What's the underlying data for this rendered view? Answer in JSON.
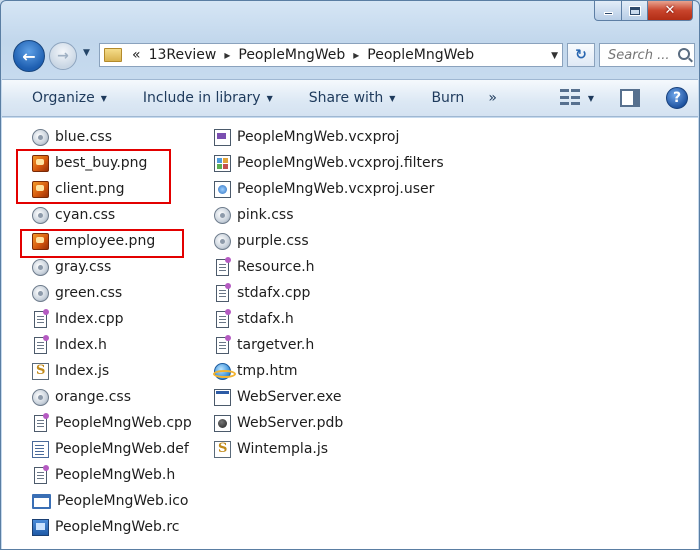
{
  "window": {
    "caption_close": "✕"
  },
  "nav": {
    "back_glyph": "←",
    "forward_glyph": "→",
    "breadcrumb_overflow": "«",
    "breadcrumb": [
      "13Review",
      "PeopleMngWeb",
      "PeopleMngWeb"
    ],
    "breadcrumb_sep": "▸",
    "refresh_glyph": "↻",
    "search_placeholder": "Search ..."
  },
  "toolbar": {
    "organize": "Organize",
    "include_in_library": "Include in library",
    "share_with": "Share with",
    "burn": "Burn",
    "more": "»",
    "dropdown_glyph": "▼",
    "help": "?"
  },
  "files": {
    "column1": [
      {
        "name": "blue.css",
        "icon": "css-file-icon"
      },
      {
        "name": "best_buy.png",
        "icon": "png-image-icon"
      },
      {
        "name": "client.png",
        "icon": "png-image-icon"
      },
      {
        "name": "cyan.css",
        "icon": "css-file-icon"
      },
      {
        "name": "employee.png",
        "icon": "png-image-icon"
      },
      {
        "name": "gray.css",
        "icon": "css-file-icon"
      },
      {
        "name": "green.css",
        "icon": "css-file-icon"
      },
      {
        "name": "Index.cpp",
        "icon": "cpp-file-icon"
      },
      {
        "name": "Index.h",
        "icon": "header-file-icon"
      },
      {
        "name": "Index.js",
        "icon": "js-file-icon"
      },
      {
        "name": "orange.css",
        "icon": "css-file-icon"
      },
      {
        "name": "PeopleMngWeb.cpp",
        "icon": "cpp-file-icon"
      },
      {
        "name": "PeopleMngWeb.def",
        "icon": "def-file-icon"
      },
      {
        "name": "PeopleMngWeb.h",
        "icon": "header-file-icon"
      },
      {
        "name": "PeopleMngWeb.ico",
        "icon": "ico-file-icon"
      },
      {
        "name": "PeopleMngWeb.rc",
        "icon": "rc-file-icon"
      }
    ],
    "column2": [
      {
        "name": "PeopleMngWeb.vcxproj",
        "icon": "vcxproj-file-icon"
      },
      {
        "name": "PeopleMngWeb.vcxproj.filters",
        "icon": "filters-file-icon"
      },
      {
        "name": "PeopleMngWeb.vcxproj.user",
        "icon": "user-file-icon"
      },
      {
        "name": "pink.css",
        "icon": "css-file-icon"
      },
      {
        "name": "purple.css",
        "icon": "css-file-icon"
      },
      {
        "name": "Resource.h",
        "icon": "header-file-icon"
      },
      {
        "name": "stdafx.cpp",
        "icon": "cpp-file-icon"
      },
      {
        "name": "stdafx.h",
        "icon": "header-file-icon"
      },
      {
        "name": "targetver.h",
        "icon": "header-file-icon"
      },
      {
        "name": "tmp.htm",
        "icon": "htm-file-icon"
      },
      {
        "name": "WebServer.exe",
        "icon": "exe-file-icon"
      },
      {
        "name": "WebServer.pdb",
        "icon": "pdb-file-icon"
      },
      {
        "name": "Wintempla.js",
        "icon": "js-file-icon"
      }
    ]
  },
  "highlight_color": "#e30000"
}
